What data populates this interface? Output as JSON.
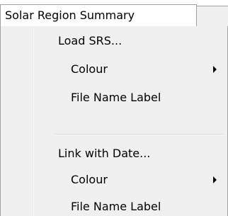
{
  "menu": {
    "title": "Solar Region Summary",
    "groups": [
      {
        "items": [
          {
            "label": "Load SRS...",
            "submenu": false
          },
          {
            "label": "Colour",
            "submenu": true
          },
          {
            "label": "File Name Label",
            "submenu": false
          }
        ]
      },
      {
        "items": [
          {
            "label": "Link with Date...",
            "submenu": false
          },
          {
            "label": "Colour",
            "submenu": true
          },
          {
            "label": "File Name Label",
            "submenu": false
          }
        ]
      }
    ]
  },
  "colors": {
    "menu_background": "#f0f0f0",
    "border": "#a0a0a0",
    "text": "#000000"
  }
}
